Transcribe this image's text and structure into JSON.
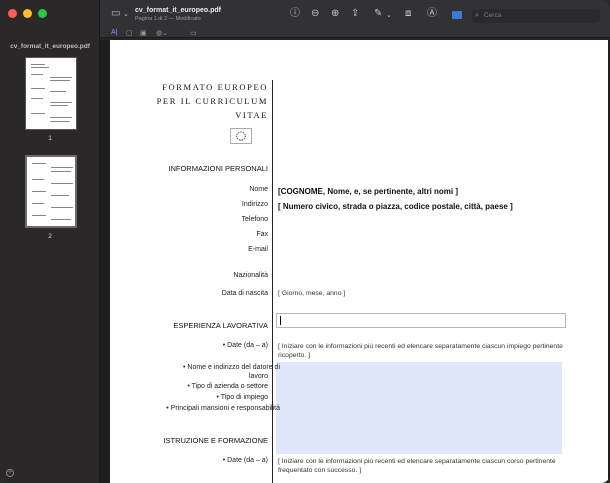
{
  "sidebar": {
    "filename": "cv_format_it_europeo.pdf",
    "pages": [
      {
        "num": "1"
      },
      {
        "num": "2"
      }
    ]
  },
  "toolbar": {
    "title": "cv_format_it_europeo.pdf",
    "subtitle": "Pagina 1 di 2 — Modificato",
    "search_placeholder": "Cerca"
  },
  "document": {
    "header_lines": [
      "FORMATO EUROPEO",
      "PER IL CURRICULUM",
      "VITAE"
    ],
    "personal": {
      "title": "INFORMAZIONI PERSONALI",
      "labels": [
        "Nome",
        "Indirizzo",
        "Telefono",
        "Fax",
        "E-mail",
        "Nazionalità",
        "Data di nascita"
      ],
      "name_value": "[COGNOME, Nome, e, se pertinente, altri nomi ]",
      "address_value": "[ Numero civico, strada o piazza, codice postale, città, paese ]",
      "dob_value": "[ Giorno, mese, anno ]"
    },
    "experience": {
      "title": "ESPERIENZA LAVORATIVA",
      "labels": [
        "• Date (da – a)",
        "• Nome e indirizzo del datore di",
        "lavoro",
        "• Tipo di azienda o settore",
        "• Tipo di impiego",
        "• Principali mansioni e responsabilità"
      ],
      "hint": "[ Iniziare con le informazioni più recenti ed elencare separatamente ciascun impiego pertinente ricoperto. ]"
    },
    "education": {
      "title": "ISTRUZIONE E FORMAZIONE",
      "labels": [
        "• Date (da – a)"
      ],
      "hint": "[ Iniziare con le informazioni più recenti ed elencare separatamente ciascun corso pertinente frequentato con successo. ]"
    }
  },
  "colors": {
    "red": "#ff5f57",
    "yellow": "#febc2e",
    "green": "#28c840",
    "accent": "#3f7bd6",
    "fill": "#dfe8fb"
  }
}
